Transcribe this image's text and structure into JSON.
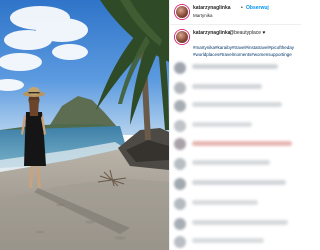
{
  "post": {
    "username": "katarzynaglinka",
    "follow_label": "Obserwuj",
    "dot": "•",
    "location": "Martynika"
  },
  "caption": {
    "username": "katarzynaglinka",
    "text": "@beautyplace",
    "heart": "♥",
    "hashtag_lines": [
      "#martynika#karaiby#travel#instatravel#picoftheday",
      "#worldplaces#travelmoments#womensupportinge"
    ]
  },
  "colors": {
    "follow_blue": "#0095f6",
    "text": "#262626",
    "hashtag": "#00376b",
    "border": "#efefef"
  },
  "icons": {
    "avatar": "profile-photo",
    "heart": "black-heart-emoji"
  }
}
